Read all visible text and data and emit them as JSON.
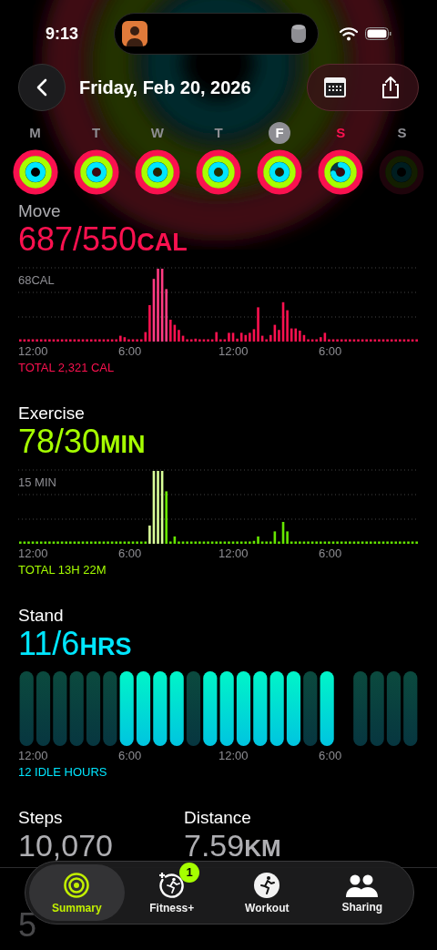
{
  "status_bar": {
    "time": "9:13"
  },
  "nav": {
    "title": "Friday, Feb 20, 2026"
  },
  "week": [
    {
      "label": "M",
      "selected": false,
      "today": false,
      "dimmed": false,
      "rings": [
        {
          "kind": "move",
          "closed": true
        },
        {
          "kind": "exercise",
          "closed": true
        },
        {
          "kind": "stand",
          "closed": true
        }
      ]
    },
    {
      "label": "T",
      "selected": false,
      "today": false,
      "dimmed": false,
      "rings": [
        {
          "kind": "move",
          "closed": true
        },
        {
          "kind": "exercise",
          "closed": true
        },
        {
          "kind": "stand",
          "closed": true
        }
      ]
    },
    {
      "label": "W",
      "selected": false,
      "today": false,
      "dimmed": false,
      "rings": [
        {
          "kind": "move",
          "closed": true
        },
        {
          "kind": "exercise",
          "closed": true
        },
        {
          "kind": "stand",
          "closed": true
        }
      ]
    },
    {
      "label": "T",
      "selected": false,
      "today": false,
      "dimmed": false,
      "rings": [
        {
          "kind": "move",
          "closed": true
        },
        {
          "kind": "exercise",
          "closed": true
        },
        {
          "kind": "stand",
          "closed": true
        }
      ]
    },
    {
      "label": "F",
      "selected": true,
      "today": false,
      "dimmed": false,
      "rings": [
        {
          "kind": "move",
          "closed": true
        },
        {
          "kind": "exercise",
          "closed": true
        },
        {
          "kind": "stand",
          "closed": true
        }
      ]
    },
    {
      "label": "S",
      "selected": false,
      "today": true,
      "dimmed": false,
      "rings": [
        {
          "kind": "move",
          "closed": true
        },
        {
          "kind": "exercise",
          "closed": true
        },
        {
          "kind": "stand",
          "closed": false
        }
      ]
    },
    {
      "label": "S",
      "selected": false,
      "today": false,
      "dimmed": true
    }
  ],
  "sections": [
    {
      "kind": "move",
      "title": "Move",
      "value": "687/550",
      "unit": "CAL",
      "max_label": "68CAL",
      "axis": [
        "12:00",
        "6:00",
        "12:00",
        "6:00"
      ],
      "footer": "TOTAL 2,321 CAL"
    },
    {
      "kind": "exercise",
      "title": "Exercise",
      "value": "78/30",
      "unit": "MIN",
      "max_label": "15 MIN",
      "axis": [
        "12:00",
        "6:00",
        "12:00",
        "6:00"
      ],
      "footer": "TOTAL 13H 22M"
    },
    {
      "kind": "stand",
      "title": "Stand",
      "value": "11/6",
      "unit": "HRS",
      "axis": [
        "12:00",
        "6:00",
        "12:00",
        "6:00"
      ],
      "footer": "12 IDLE HOURS",
      "hours": [
        {
          "kind": "hour",
          "stood": false
        },
        {
          "kind": "hour",
          "stood": false
        },
        {
          "kind": "hour",
          "stood": false
        },
        {
          "kind": "hour",
          "stood": false
        },
        {
          "kind": "hour",
          "stood": false
        },
        {
          "kind": "hour",
          "stood": false
        },
        {
          "kind": "hour",
          "stood": true
        },
        {
          "kind": "hour",
          "stood": true
        },
        {
          "kind": "hour",
          "stood": true
        },
        {
          "kind": "hour",
          "stood": true
        },
        {
          "kind": "hour",
          "stood": false
        },
        {
          "kind": "hour",
          "stood": true
        },
        {
          "kind": "hour",
          "stood": true
        },
        {
          "kind": "hour",
          "stood": true
        },
        {
          "kind": "hour",
          "stood": true
        },
        {
          "kind": "hour",
          "stood": true
        },
        {
          "kind": "hour",
          "stood": true
        },
        {
          "kind": "hour",
          "stood": false
        },
        {
          "kind": "hour",
          "stood": true
        },
        {
          "kind": "gap"
        },
        {
          "kind": "hour",
          "stood": false
        },
        {
          "kind": "hour",
          "stood": false
        },
        {
          "kind": "hour",
          "stood": false
        },
        {
          "kind": "hour",
          "stood": false
        }
      ]
    }
  ],
  "stats": [
    {
      "label": "Steps",
      "value": "10,070"
    },
    {
      "label": "Distance",
      "value": "7.59",
      "unit": "KM"
    }
  ],
  "partial_stat": {
    "value": "5"
  },
  "tab_bar": [
    {
      "kind": "summary",
      "label": "Summary",
      "selected": true
    },
    {
      "kind": "fitness",
      "label": "Fitness+",
      "selected": false,
      "badge": "1"
    },
    {
      "kind": "workout",
      "label": "Workout",
      "selected": false
    },
    {
      "kind": "sharing",
      "label": "Sharing",
      "selected": false
    }
  ]
}
